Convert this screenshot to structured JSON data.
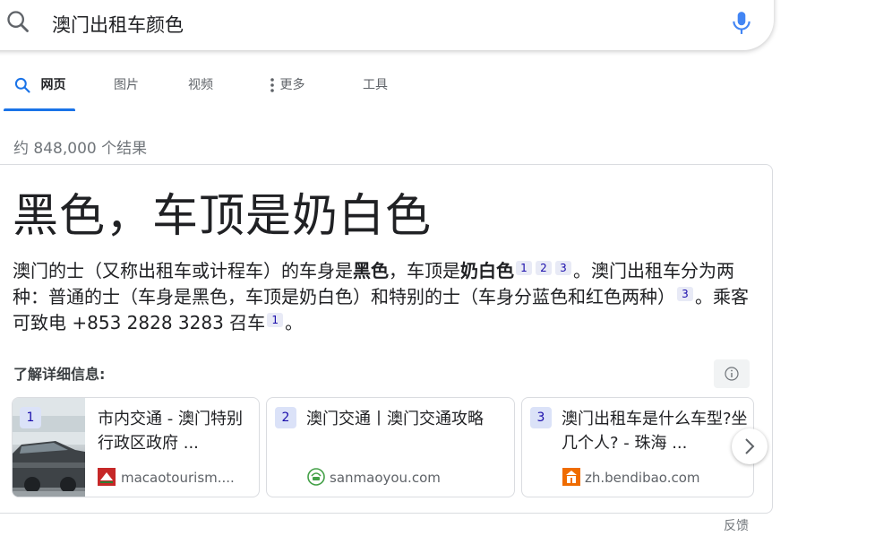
{
  "search": {
    "query": "澳门出租车颜色"
  },
  "tabs": [
    {
      "label": "网页",
      "active": true
    },
    {
      "label": "图片"
    },
    {
      "label": "视频"
    },
    {
      "label": "更多"
    },
    {
      "label": "工具"
    }
  ],
  "result_stats": "约 848,000 个结果",
  "featured": {
    "answer": "黑色，车顶是奶白色",
    "desc": {
      "p1": "澳门的士（又称出租车或计程车）的车身是",
      "b1": "黑色",
      "p2": "，车顶是",
      "b2": "奶白色",
      "c1": "1",
      "c2": "2",
      "c3": "3",
      "p3": "。澳门出租车分为两种：普通的士（车身是黑色，车顶是奶白色）和特别的士（车身分蓝色和红色两种）",
      "c4": "3",
      "p4": "。乘客可致电 +853 2828 3283 召车",
      "c5": "1",
      "p5": "。"
    },
    "learn_more": "了解详细信息:",
    "sources": [
      {
        "num": "1",
        "title": "市内交通 - 澳门特别行政区政府 ...",
        "site": "macaotourism...."
      },
      {
        "num": "2",
        "title": "澳门交通丨澳门交通攻略",
        "site": "sanmaoyou.com"
      },
      {
        "num": "3",
        "title": "澳门出租车是什么车型?坐几个人? - 珠海 ...",
        "site": "zh.bendibao.com"
      }
    ]
  },
  "feedback": "反馈",
  "colors": {
    "accent": "#1a73e8",
    "link": "#1a0dab",
    "cite_bg": "#e8eaf6"
  }
}
